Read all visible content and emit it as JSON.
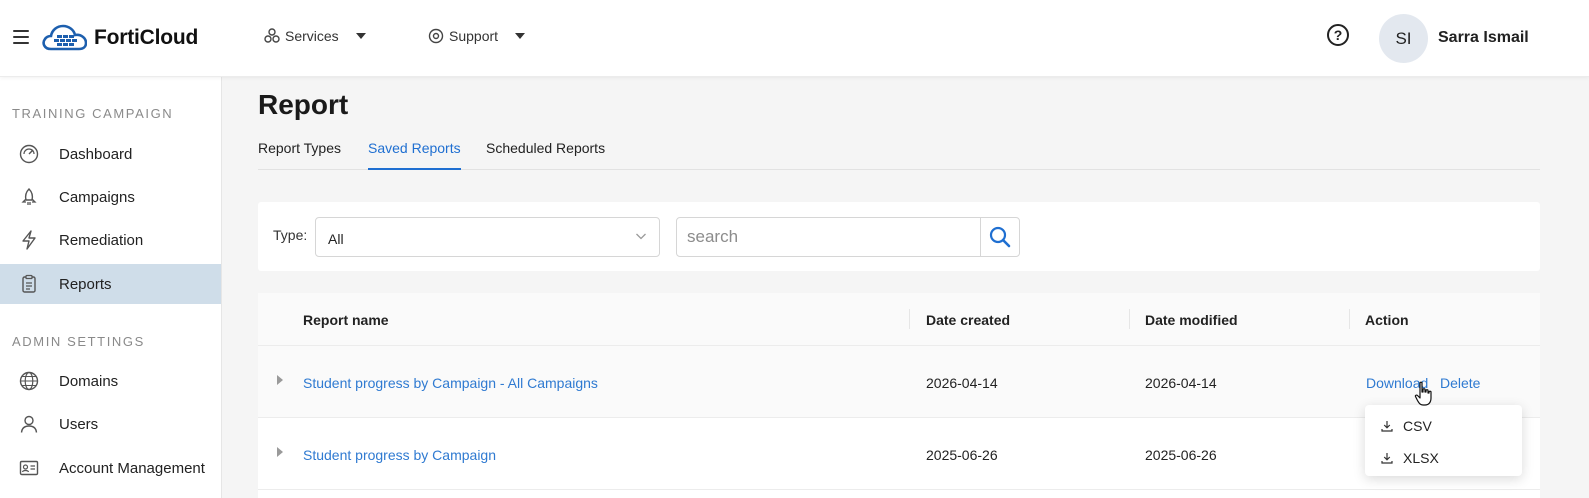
{
  "header": {
    "brand": "FortiCloud",
    "nav": [
      {
        "label": "Services"
      },
      {
        "label": "Support"
      }
    ],
    "help_symbol": "?",
    "user": {
      "initials": "SI",
      "name": "Sarra Ismail"
    }
  },
  "sidebar": {
    "sections": [
      {
        "label": "TRAINING CAMPAIGN"
      },
      {
        "label": "ADMIN SETTINGS"
      }
    ],
    "items": [
      {
        "label": "Dashboard",
        "icon": "gauge-icon"
      },
      {
        "label": "Campaigns",
        "icon": "rocket-icon"
      },
      {
        "label": "Remediation",
        "icon": "lightning-icon"
      },
      {
        "label": "Reports",
        "icon": "clipboard-icon",
        "active": true
      },
      {
        "label": "Domains",
        "icon": "globe-icon"
      },
      {
        "label": "Users",
        "icon": "user-icon"
      },
      {
        "label": "Account Management",
        "icon": "id-card-icon"
      }
    ]
  },
  "page": {
    "title": "Report",
    "tabs": [
      {
        "label": "Report Types"
      },
      {
        "label": "Saved Reports",
        "active": true
      },
      {
        "label": "Scheduled Reports"
      }
    ]
  },
  "filters": {
    "type_label": "Type:",
    "type_value": "All",
    "search_placeholder": "search"
  },
  "table": {
    "columns": [
      "Report name",
      "Date created",
      "Date modified",
      "Action"
    ],
    "rows": [
      {
        "name": "Student progress by Campaign - All Campaigns",
        "created": "2026-04-14",
        "modified": "2026-04-14",
        "download": "Download",
        "delete": "Delete"
      },
      {
        "name": "Student progress by Campaign",
        "created": "2025-06-26",
        "modified": "2025-06-26"
      }
    ]
  },
  "download_menu": {
    "items": [
      {
        "label": "CSV",
        "icon": "download-icon"
      },
      {
        "label": "XLSX",
        "icon": "download-icon"
      }
    ]
  },
  "colors": {
    "accent": "#1f6fd1",
    "link": "#2f7ad1",
    "active_nav_bg": "#cfdde9",
    "logo_blue": "#1d5fae"
  }
}
